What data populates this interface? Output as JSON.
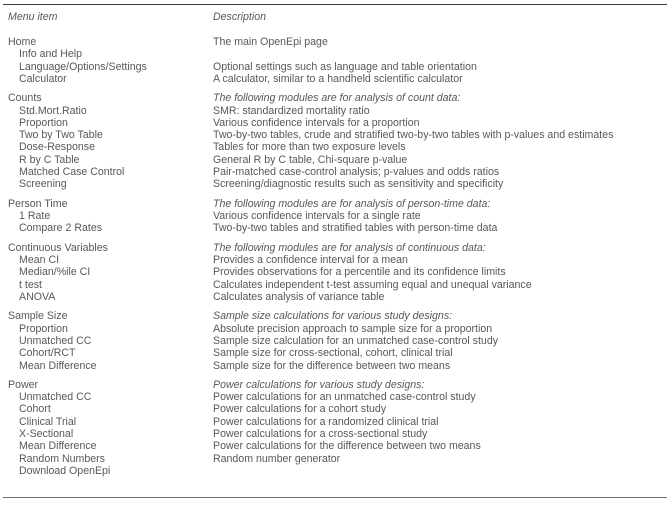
{
  "table": {
    "columns": {
      "menu_header": "Menu item",
      "description_header": "Description"
    },
    "rows": [
      {
        "menu": "Home",
        "level": 0,
        "desc": "The main OpenEpi page",
        "desc_italic": false,
        "group_start": true
      },
      {
        "menu": "Info and Help",
        "level": 1,
        "desc": "",
        "desc_italic": false,
        "group_start": false
      },
      {
        "menu": "Language/Options/Settings",
        "level": 1,
        "desc": "Optional settings such as language and table orientation",
        "desc_italic": false,
        "group_start": false
      },
      {
        "menu": "Calculator",
        "level": 1,
        "desc": "A calculator, similar to a handheld scientific calculator",
        "desc_italic": false,
        "group_start": false
      },
      {
        "menu": "Counts",
        "level": 0,
        "desc": "The following modules are for analysis of count data:",
        "desc_italic": true,
        "group_start": true
      },
      {
        "menu": "Std.Mort.Ratio",
        "level": 1,
        "desc": "SMR: standardized mortality ratio",
        "desc_italic": false,
        "group_start": false
      },
      {
        "menu": "Proportion",
        "level": 1,
        "desc": "Various confidence intervals for a proportion",
        "desc_italic": false,
        "group_start": false
      },
      {
        "menu": "Two by Two Table",
        "level": 1,
        "desc": "Two-by-two tables, crude and stratified two-by-two tables with p-values and estimates",
        "desc_italic": false,
        "group_start": false
      },
      {
        "menu": "Dose-Response",
        "level": 1,
        "desc": "Tables for more than two exposure levels",
        "desc_italic": false,
        "group_start": false
      },
      {
        "menu": "R by C Table",
        "level": 1,
        "desc": "General R by C table, Chi-square p-value",
        "desc_italic": false,
        "group_start": false
      },
      {
        "menu": "Matched Case Control",
        "level": 1,
        "desc": "Pair-matched case-control analysis; p-values and odds ratios",
        "desc_italic": false,
        "group_start": false
      },
      {
        "menu": "Screening",
        "level": 1,
        "desc": "Screening/diagnostic results such as sensitivity and specificity",
        "desc_italic": false,
        "group_start": false
      },
      {
        "menu": "Person Time",
        "level": 0,
        "desc": "The following modules are for analysis of person-time data:",
        "desc_italic": true,
        "group_start": true
      },
      {
        "menu": "1 Rate",
        "level": 1,
        "desc": "Various confidence intervals for a single rate",
        "desc_italic": false,
        "group_start": false
      },
      {
        "menu": "Compare 2 Rates",
        "level": 1,
        "desc": "Two-by-two tables and stratified tables with person-time data",
        "desc_italic": false,
        "group_start": false
      },
      {
        "menu": "Continuous Variables",
        "level": 0,
        "desc": "The following modules are for analysis of continuous data:",
        "desc_italic": true,
        "group_start": true
      },
      {
        "menu": "Mean CI",
        "level": 1,
        "desc": "Provides a confidence interval for a mean",
        "desc_italic": false,
        "group_start": false
      },
      {
        "menu": "Median/%ile CI",
        "level": 1,
        "desc": "Provides observations for a percentile and its confidence limits",
        "desc_italic": false,
        "group_start": false
      },
      {
        "menu": "t test",
        "level": 1,
        "desc": "Calculates independent t-test assuming equal and unequal variance",
        "desc_italic": false,
        "group_start": false
      },
      {
        "menu": "ANOVA",
        "level": 1,
        "desc": "Calculates analysis of variance table",
        "desc_italic": false,
        "group_start": false
      },
      {
        "menu": "Sample Size",
        "level": 0,
        "desc": "Sample size calculations for various study designs:",
        "desc_italic": true,
        "group_start": true
      },
      {
        "menu": "Proportion",
        "level": 1,
        "desc": "Absolute precision approach to sample size for a proportion",
        "desc_italic": false,
        "group_start": false
      },
      {
        "menu": "Unmatched CC",
        "level": 1,
        "desc": "Sample size calculation for an unmatched case-control study",
        "desc_italic": false,
        "group_start": false
      },
      {
        "menu": "Cohort/RCT",
        "level": 1,
        "desc": "Sample size for cross-sectional, cohort, clinical trial",
        "desc_italic": false,
        "group_start": false
      },
      {
        "menu": "Mean Difference",
        "level": 1,
        "desc": "Sample size for the difference between two means",
        "desc_italic": false,
        "group_start": false
      },
      {
        "menu": "Power",
        "level": 0,
        "desc": "Power calculations for various study designs:",
        "desc_italic": true,
        "group_start": true
      },
      {
        "menu": "Unmatched CC",
        "level": 1,
        "desc": "Power calculations for an unmatched case-control study",
        "desc_italic": false,
        "group_start": false
      },
      {
        "menu": "Cohort",
        "level": 1,
        "desc": "Power calculations for a cohort study",
        "desc_italic": false,
        "group_start": false
      },
      {
        "menu": "Clinical Trial",
        "level": 1,
        "desc": "Power calculations for a randomized clinical trial",
        "desc_italic": false,
        "group_start": false
      },
      {
        "menu": "X-Sectional",
        "level": 1,
        "desc": "Power calculations for a cross-sectional study",
        "desc_italic": false,
        "group_start": false
      },
      {
        "menu": "Mean Difference",
        "level": 1,
        "desc": "Power calculations for the difference between two means",
        "desc_italic": false,
        "group_start": false
      },
      {
        "menu": "Random Numbers",
        "level": 1,
        "desc": "Random number generator",
        "desc_italic": false,
        "group_start": false
      },
      {
        "menu": "Download OpenEpi",
        "level": 1,
        "desc": "",
        "desc_italic": false,
        "group_start": false
      }
    ]
  }
}
